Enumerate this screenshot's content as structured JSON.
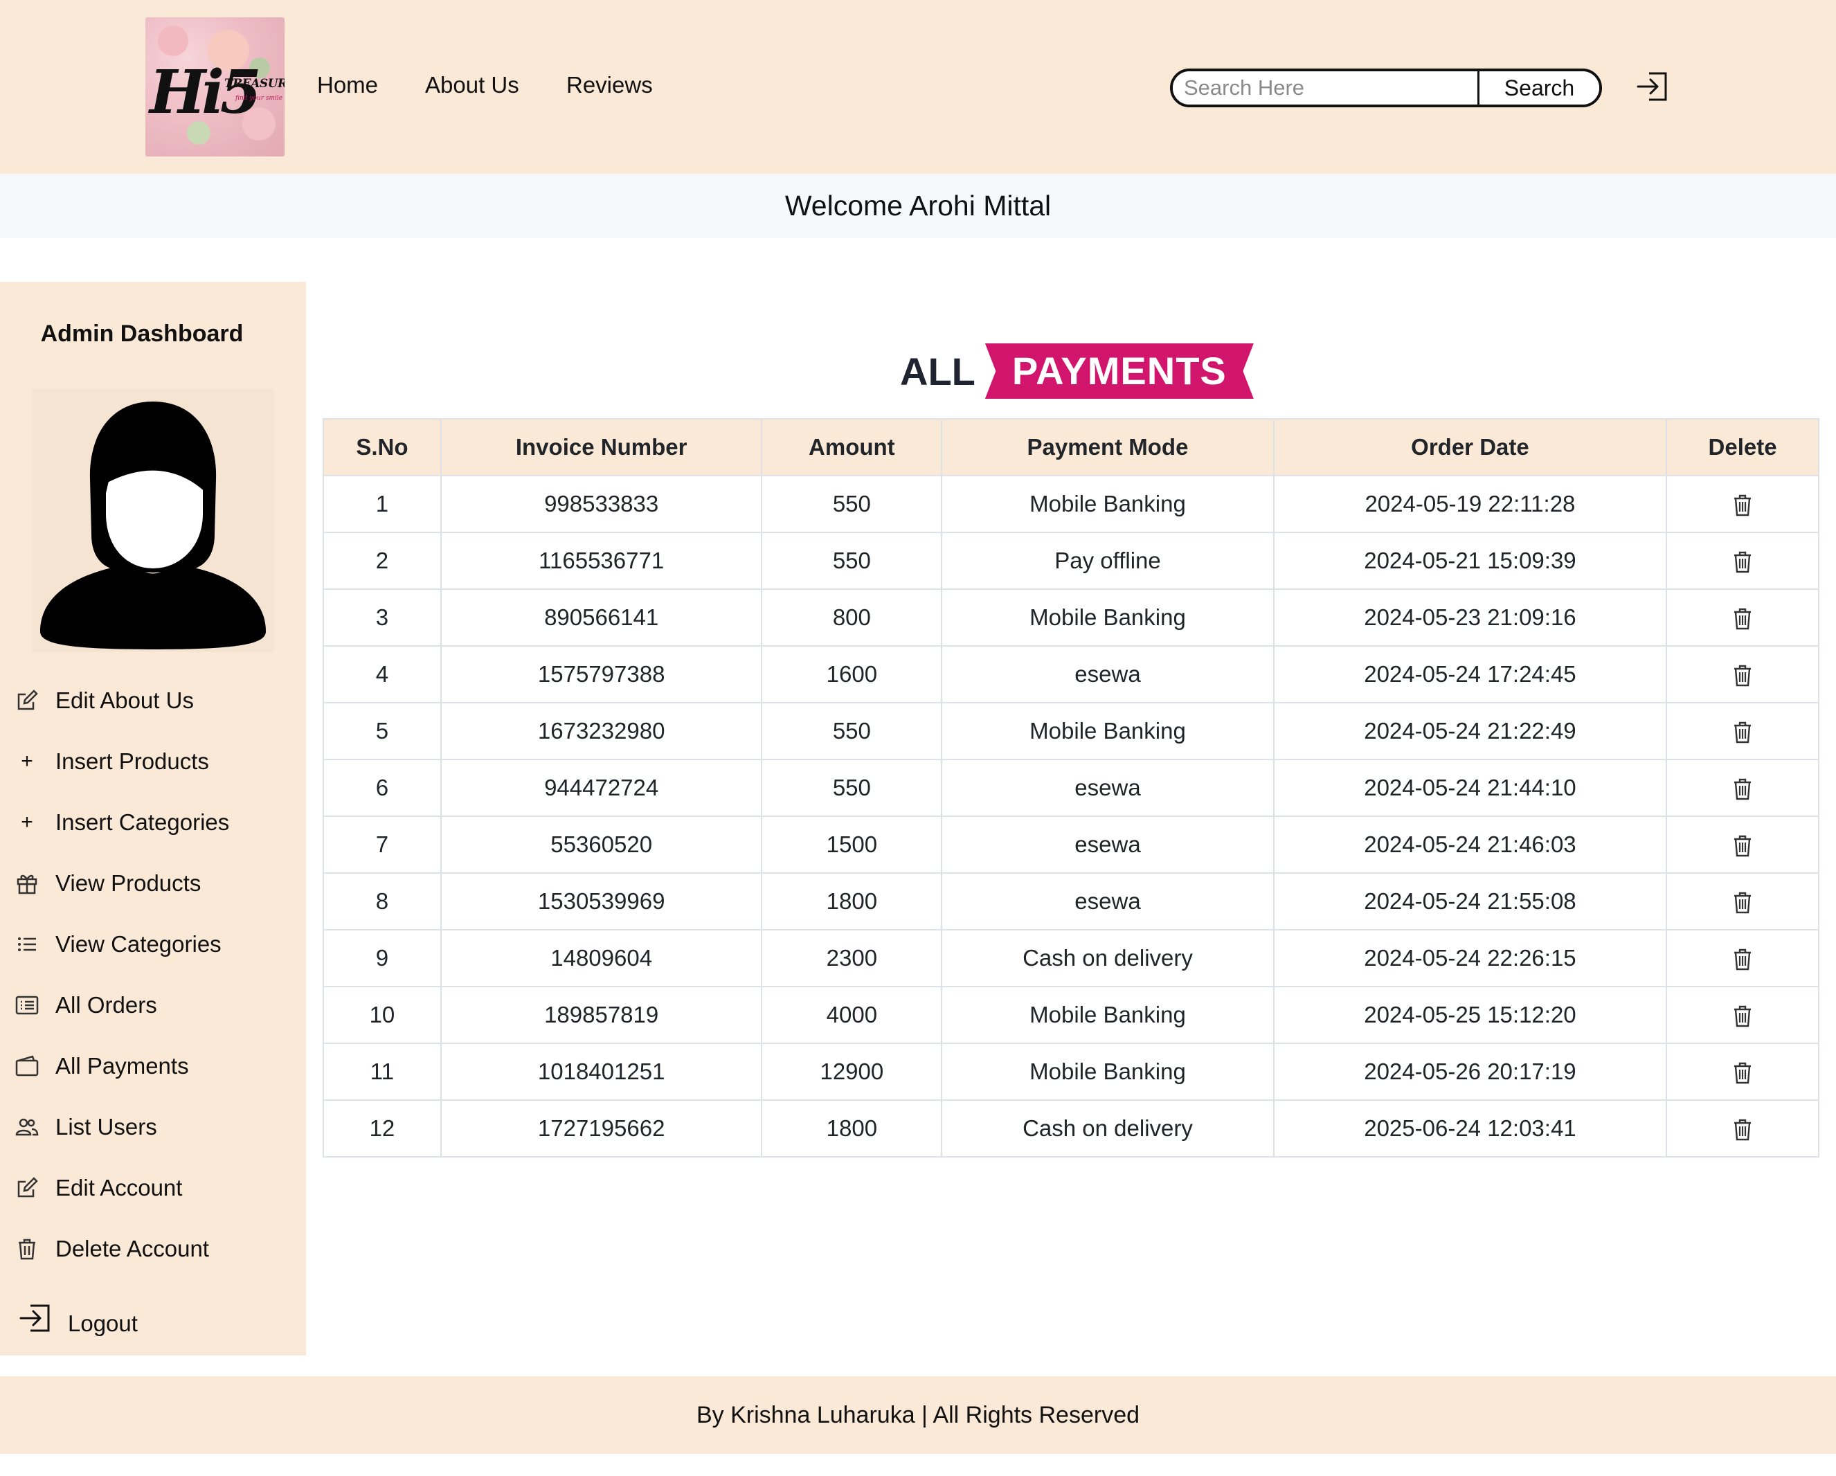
{
  "header": {
    "logo_text": "Hi5",
    "logo_subtext": "TREASURES",
    "logo_tagline": "find your smile",
    "nav": {
      "home": "Home",
      "about": "About Us",
      "reviews": "Reviews"
    },
    "search": {
      "placeholder": "Search Here",
      "value": "",
      "button": "Search"
    },
    "login_icon": "login-icon"
  },
  "welcome": "Welcome Arohi Mittal",
  "sidebar": {
    "title": "Admin Dashboard",
    "avatar_icon": "user-female-avatar-icon",
    "items": [
      {
        "label": "Edit About Us",
        "icon": "edit-icon"
      },
      {
        "label": "Insert Products",
        "icon": "plus-icon"
      },
      {
        "label": "Insert Categories",
        "icon": "plus-icon"
      },
      {
        "label": "View Products",
        "icon": "gift-icon"
      },
      {
        "label": "View Categories",
        "icon": "list-icon"
      },
      {
        "label": "All Orders",
        "icon": "card-list-icon"
      },
      {
        "label": "All Payments",
        "icon": "wallet-icon"
      },
      {
        "label": "List Users",
        "icon": "users-icon"
      },
      {
        "label": "Edit Account",
        "icon": "edit-icon"
      },
      {
        "label": "Delete Account",
        "icon": "trash-icon"
      },
      {
        "label": "Logout",
        "icon": "logout-icon"
      }
    ]
  },
  "main": {
    "heading_prefix": "ALL",
    "heading_highlight": "PAYMENTS",
    "highlight_color": "#d1146c",
    "table": {
      "headers": [
        "S.No",
        "Invoice Number",
        "Amount",
        "Payment Mode",
        "Order Date",
        "Delete"
      ],
      "rows": [
        [
          "1",
          "998533833",
          "550",
          "Mobile Banking",
          "2024-05-19 22:11:28"
        ],
        [
          "2",
          "1165536771",
          "550",
          "Pay offline",
          "2024-05-21 15:09:39"
        ],
        [
          "3",
          "890566141",
          "800",
          "Mobile Banking",
          "2024-05-23 21:09:16"
        ],
        [
          "4",
          "1575797388",
          "1600",
          "esewa",
          "2024-05-24 17:24:45"
        ],
        [
          "5",
          "1673232980",
          "550",
          "Mobile Banking",
          "2024-05-24 21:22:49"
        ],
        [
          "6",
          "944472724",
          "550",
          "esewa",
          "2024-05-24 21:44:10"
        ],
        [
          "7",
          "55360520",
          "1500",
          "esewa",
          "2024-05-24 21:46:03"
        ],
        [
          "8",
          "1530539969",
          "1800",
          "esewa",
          "2024-05-24 21:55:08"
        ],
        [
          "9",
          "14809604",
          "2300",
          "Cash on delivery",
          "2024-05-24 22:26:15"
        ],
        [
          "10",
          "189857819",
          "4000",
          "Mobile Banking",
          "2024-05-25 15:12:20"
        ],
        [
          "11",
          "1018401251",
          "12900",
          "Mobile Banking",
          "2024-05-26 20:17:19"
        ],
        [
          "12",
          "1727195662",
          "1800",
          "Cash on delivery",
          "2025-06-24 12:03:41"
        ]
      ],
      "delete_icon": "trash-icon"
    }
  },
  "footer": "By Krishna Luharuka | All Rights Reserved",
  "colors": {
    "header_bg": "#fae9d6",
    "welcome_bg": "#f7f8fa",
    "accent": "#d1146c"
  }
}
